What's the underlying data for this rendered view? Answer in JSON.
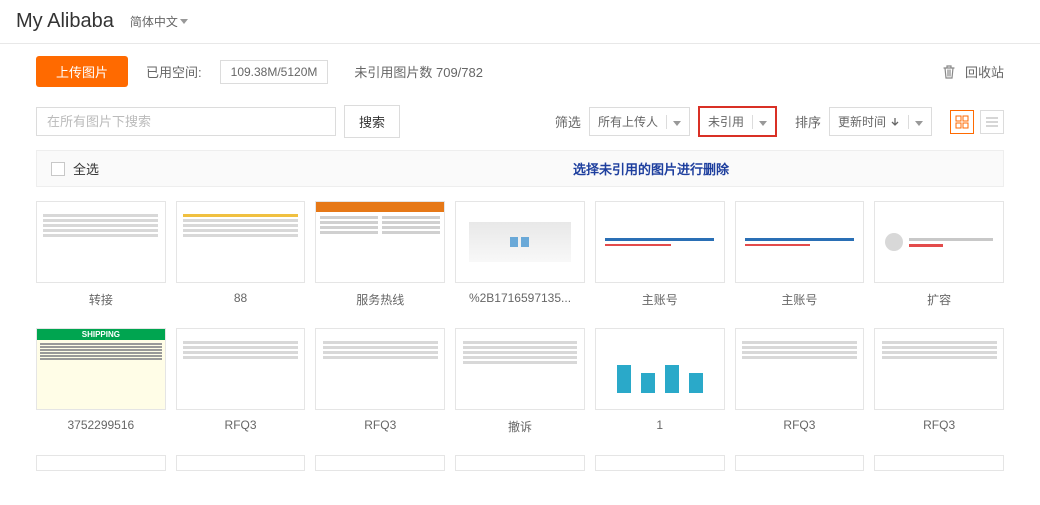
{
  "header": {
    "brand": "My Alibaba",
    "language": "简体中文"
  },
  "toolbar": {
    "upload_label": "上传图片",
    "usage_label": "已用空间:",
    "usage_value": "109.38M/5120M",
    "unreferenced_label": "未引用图片数 709/782",
    "recycle_label": "回收站"
  },
  "filter": {
    "search_placeholder": "在所有图片下搜索",
    "search_button": "搜索",
    "filter_label": "筛选",
    "uploader_value": "所有上传人",
    "reference_value": "未引用",
    "sort_label": "排序",
    "sort_value": "更新时间"
  },
  "selectall": {
    "label": "全选",
    "hint": "选择未引用的图片进行删除"
  },
  "row1": [
    {
      "caption": "转接"
    },
    {
      "caption": "88"
    },
    {
      "caption": "服务热线"
    },
    {
      "caption": "%2B1716597135..."
    },
    {
      "caption": "主账号"
    },
    {
      "caption": "主账号"
    },
    {
      "caption": "扩容"
    }
  ],
  "row2": [
    {
      "caption": "3752299516"
    },
    {
      "caption": "RFQ3"
    },
    {
      "caption": "RFQ3"
    },
    {
      "caption": "撤诉"
    },
    {
      "caption": "1"
    },
    {
      "caption": "RFQ3"
    },
    {
      "caption": "RFQ3"
    }
  ]
}
